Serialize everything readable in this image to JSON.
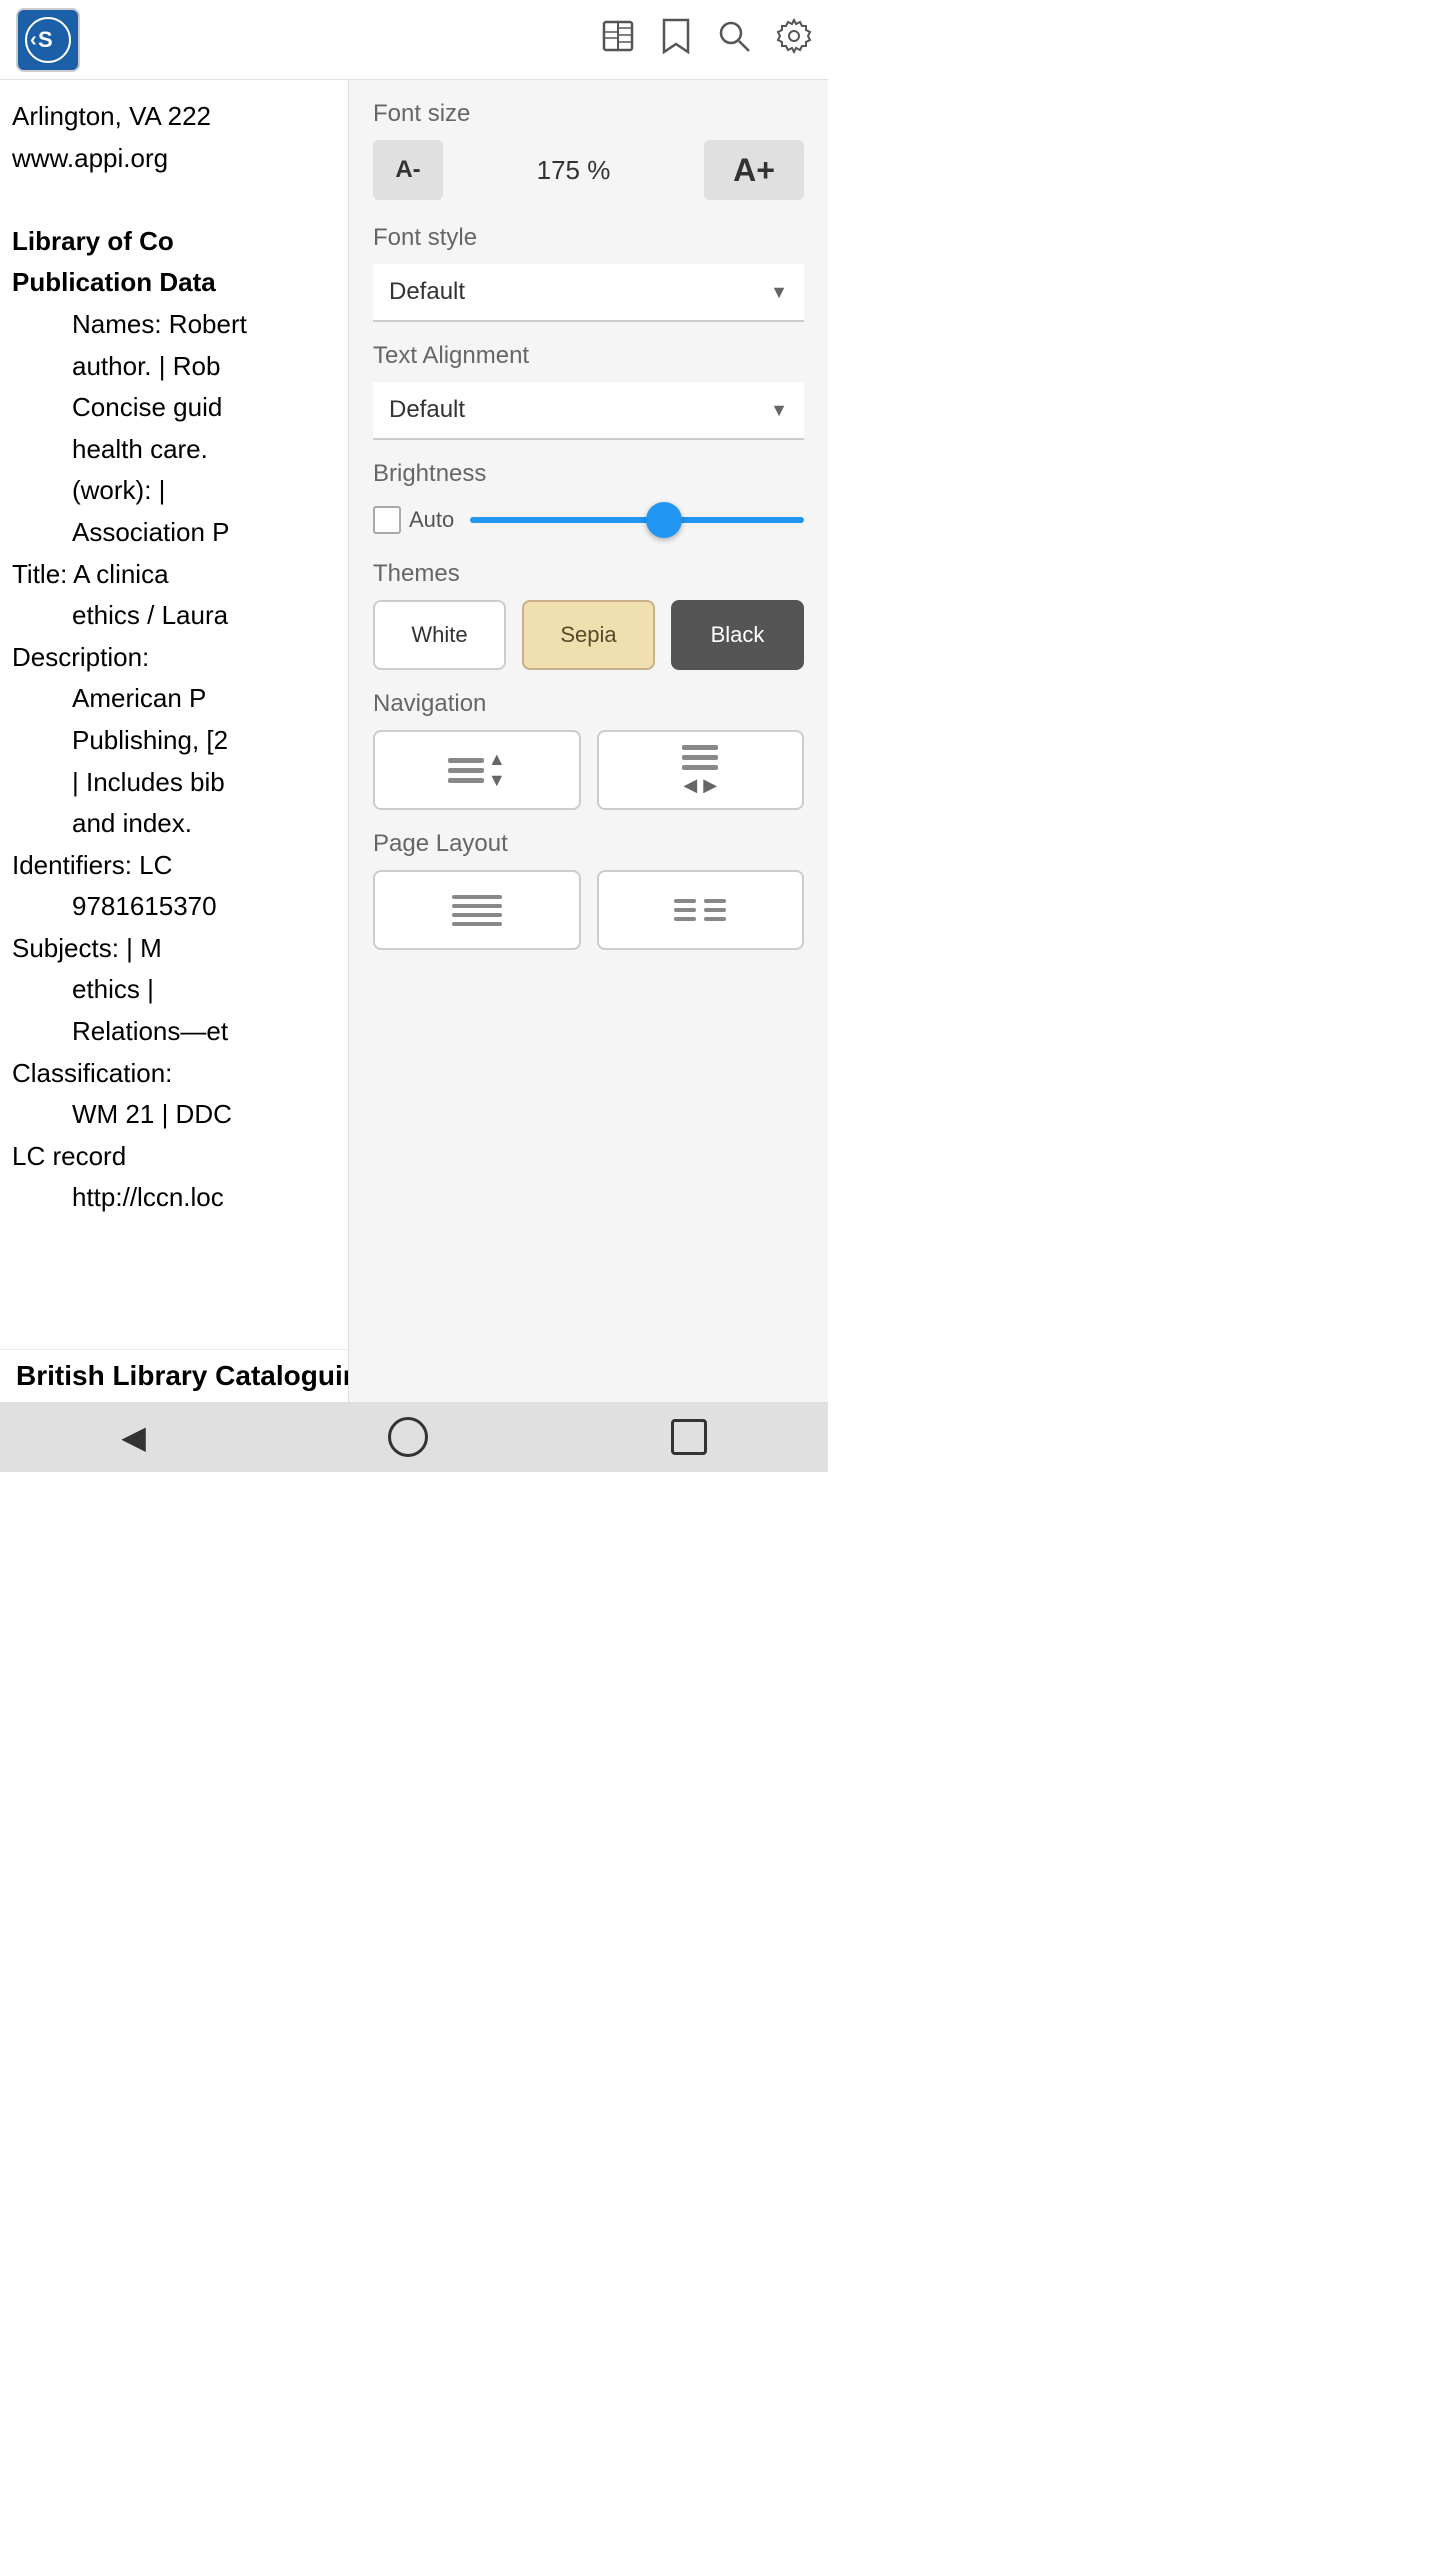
{
  "topBar": {
    "logoAlt": "APPI logo",
    "backLabel": "‹",
    "icons": {
      "book": "📖",
      "bookmark": "🔖",
      "search": "🔍",
      "settings": "⚙️"
    }
  },
  "bookContent": {
    "lines": [
      "Arlington, VA 222",
      "www.appi.org",
      "Library of Co",
      "Publication Data",
      "Names: Robert",
      "author. | Rob",
      "Concise guid",
      "health care.",
      "(work): |",
      "Association P",
      "Title: A clinica",
      "ethics / Laura",
      "Description:",
      "American P",
      "Publishing, [2",
      "| Includes bib",
      "and index.",
      "Identifiers: LC",
      "9781615370",
      "Subjects: | M",
      "ethics |",
      "Relations—et",
      "Classification:",
      "WM 21 | DDC",
      "LC record",
      "http://lccn.loc"
    ]
  },
  "settingsPanel": {
    "fontSizeLabel": "Font size",
    "fontDecrease": "A-",
    "fontPercent": "175 %",
    "fontIncrease": "A+",
    "fontStyleLabel": "Font style",
    "fontStyleValue": "Default",
    "textAlignmentLabel": "Text Alignment",
    "textAlignmentValue": "Default",
    "brightnessLabel": "Brightness",
    "autoLabel": "Auto",
    "brightnessValue": 58,
    "themesLabel": "Themes",
    "themes": [
      {
        "id": "white",
        "label": "White",
        "active": false
      },
      {
        "id": "sepia",
        "label": "Sepia",
        "active": false
      },
      {
        "id": "black",
        "label": "Black",
        "active": true
      }
    ],
    "navigationLabel": "Navigation",
    "navOptions": [
      {
        "id": "vertical",
        "label": "Vertical scroll"
      },
      {
        "id": "horizontal",
        "label": "Horizontal scroll"
      }
    ],
    "pageLayoutLabel": "Page Layout",
    "layoutOptions": [
      {
        "id": "single",
        "label": "Single column"
      },
      {
        "id": "double",
        "label": "Double column"
      }
    ]
  },
  "bottomBar": {
    "backLabel": "◀",
    "homeLabel": "⬤",
    "squareLabel": "■"
  },
  "footer": {
    "text": "British     Library     Cataloguing     in"
  }
}
